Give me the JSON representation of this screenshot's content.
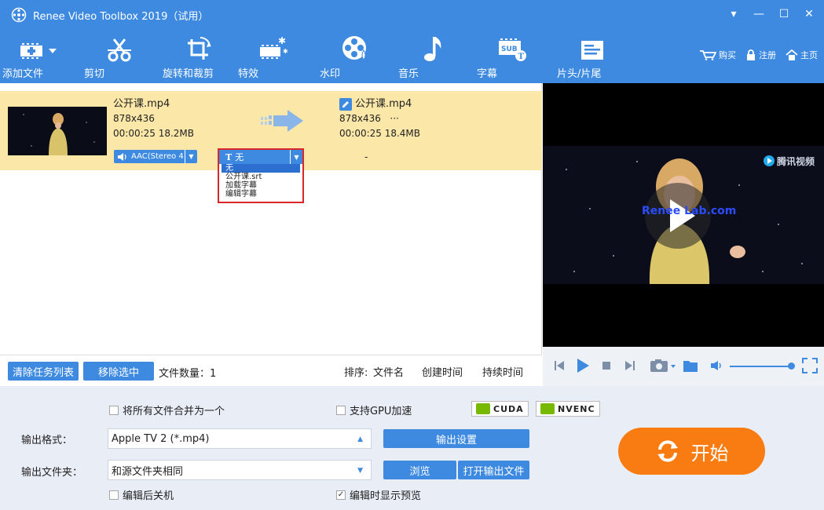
{
  "window": {
    "title": "Renee Video Toolbox 2019（试用）",
    "controls": [
      "▾",
      "—",
      "☐",
      "✕"
    ]
  },
  "toolbar": {
    "items": [
      {
        "label": "添加文件",
        "icon": "add-file-icon"
      },
      {
        "label": "剪切",
        "icon": "scissors-icon"
      },
      {
        "label": "旋转和裁剪",
        "icon": "rotate-crop-icon"
      },
      {
        "label": "特效",
        "icon": "effects-icon"
      },
      {
        "label": "水印",
        "icon": "watermark-icon"
      },
      {
        "label": "音乐",
        "icon": "music-icon"
      },
      {
        "label": "字幕",
        "icon": "subtitle-icon"
      },
      {
        "label": "片头/片尾",
        "icon": "intro-outro-icon"
      }
    ],
    "links": {
      "buy": "购买",
      "register": "注册",
      "home": "主页"
    }
  },
  "file": {
    "source": {
      "name": "公开课.mp4",
      "resolution": "878x436",
      "duration_size": "00:00:25 18.2MB"
    },
    "output": {
      "name": "公开课.mp4",
      "resolution": "878x436",
      "extra": "···",
      "duration_size": "00:00:25 18.4MB"
    },
    "audio": "AAC(Stereo 4",
    "dash": "-",
    "subtitle": {
      "prefix": "T",
      "value": "无",
      "options": [
        "无",
        "公开课.srt",
        "加载字幕",
        "编辑字幕"
      ],
      "selected_index": 0
    }
  },
  "list_footer": {
    "clear": "清除任务列表",
    "remove": "移除选中",
    "count_label": "文件数量：",
    "count": "1",
    "sort_label": "排序:",
    "sort_name": "文件名",
    "sort_created": "创建时间",
    "sort_duration": "持续时间"
  },
  "preview": {
    "watermark": "腾讯视频",
    "overlay_text": "Renee Lab.com"
  },
  "settings": {
    "merge": "将所有文件合并为一个",
    "merge_checked": false,
    "gpu": "支持GPU加速",
    "gpu_checked": false,
    "cuda": "CUDA",
    "nvenc": "NVENC",
    "format_label": "输出格式：",
    "format_value": "Apple TV 2 (*.mp4)",
    "output_settings": "输出设置",
    "folder_label": "输出文件夹：",
    "folder_value": "和源文件夹相同",
    "browse": "浏览",
    "open_output": "打开输出文件",
    "shutdown": "编辑后关机",
    "shutdown_checked": false,
    "show_preview": "编辑时显示预览",
    "show_preview_checked": true,
    "start": "开始"
  },
  "colors": {
    "primary": "#3d8ae0",
    "row_highlight": "#fbe7a8",
    "start": "#f97c12",
    "dropdown_border": "#d9262a",
    "nvidia": "#76b900"
  }
}
